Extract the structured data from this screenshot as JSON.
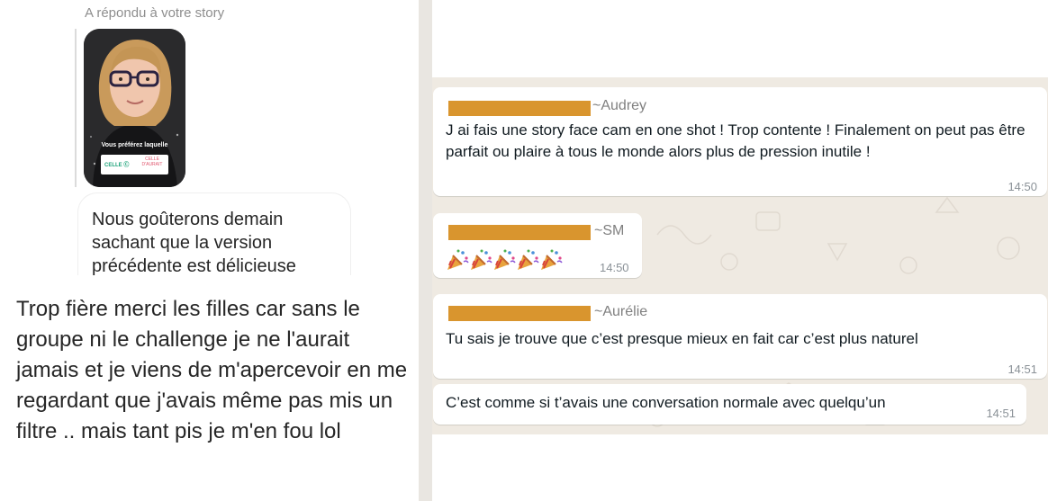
{
  "instagram": {
    "reply_label": "A répondu à votre story",
    "story": {
      "question": "Vous préférez laquelle",
      "option_1": "CELLE Ⓒ",
      "option_2": "CELLE D'AURAIT"
    },
    "message": "Nous goûterons demain sachant que la version précédente est délicieuse",
    "caption": "Trop fière merci les filles car sans le groupe ni le challenge je ne l'aurait jamais et je viens de m'apercevoir en me regardant que j'avais même pas mis un filtre .. mais tant pis je m'en fou lol"
  },
  "whatsapp": {
    "messages": [
      {
        "sender": "~Audrey",
        "text": "J ai fais une story face cam en one shot ! Trop contente ! Finalement on peut pas être parfait ou plaire à tous le monde alors plus de pression inutile !",
        "time": "14:50"
      },
      {
        "sender": "~SM",
        "text": "",
        "emoji": "party-popper",
        "emoji_count": 5,
        "time": "14:50"
      },
      {
        "sender": "~Aurélie",
        "text": "Tu sais je trouve que c’est presque mieux en fait car c’est plus naturel",
        "time": "14:51"
      },
      {
        "sender": "",
        "text": "C’est comme si t’avais une conversation normale avec quelqu’un",
        "time": "14:51"
      }
    ],
    "colors": {
      "chat_background": "#efeae2",
      "bubble": "#ffffff",
      "redaction": "#d9952e",
      "sender_name": "#808080"
    }
  }
}
